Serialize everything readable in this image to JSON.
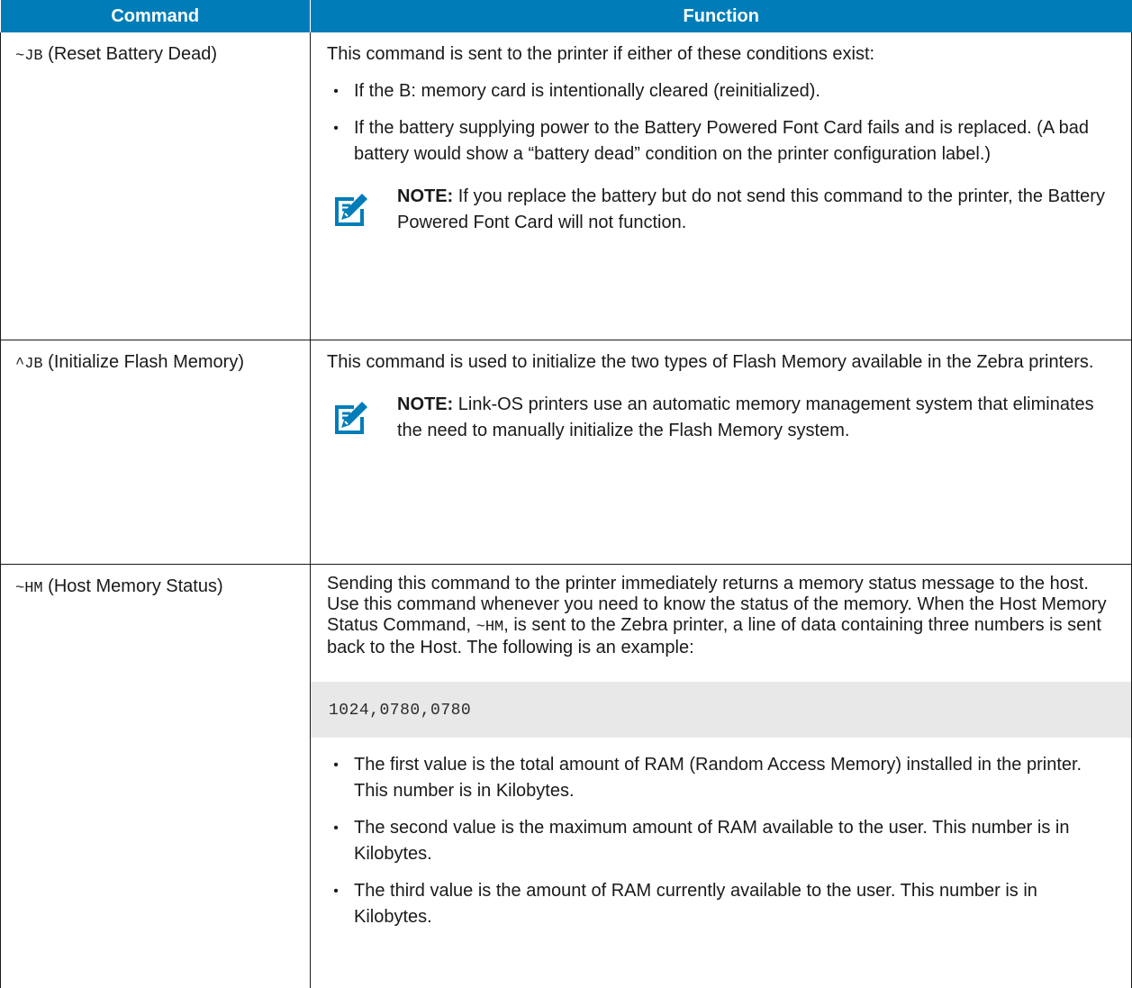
{
  "table": {
    "headers": [
      "Command",
      "Function"
    ],
    "rows": [
      {
        "command_code": "~JB",
        "command_desc": " (Reset Battery Dead)",
        "intro": "This command is sent to the printer if either of these conditions exist:",
        "bullets": [
          "If the B: memory card is intentionally cleared (reinitialized).",
          "If the battery supplying power to the Battery Powered Font Card fails and is replaced. (A bad battery would show a “battery dead” condition on the printer configuration label.)"
        ],
        "note_label": "NOTE:",
        "note_text": " If you replace the battery but do not send this command to the printer, the Battery Powered Font Card will not function."
      },
      {
        "command_code": "^JB",
        "command_desc": " (Initialize Flash Memory)",
        "intro": "This command is used to initialize the two types of Flash Memory available in the Zebra printers.",
        "note_label": "NOTE:",
        "note_text": " Link-OS printers use an automatic memory management system that eliminates the need to manually initialize the Flash Memory system."
      },
      {
        "command_code": "~HM",
        "command_desc": " (Host Memory Status)",
        "intro_a": "Sending this command to the printer immediately returns a memory status message to the host. Use this command whenever you need to know the status of the memory. When the Host Memory Status Command, ",
        "intro_code": "~HM",
        "intro_b": ", is sent to the Zebra printer, a line of data containing three numbers is sent back to the Host. The following is an example:",
        "example": "1024,0780,0780",
        "bullets": [
          "The first value is the total amount of RAM (Random Access Memory) installed in the printer. This number is in Kilobytes.",
          "The second value is the maximum amount of RAM available to the user. This number is in Kilobytes.",
          "The third value is the amount of RAM currently available to the user. This number is in Kilobytes."
        ]
      }
    ]
  },
  "icons": {
    "note": "note-pencil-icon",
    "note_color": "#007db8",
    "bullet": "•"
  },
  "colors": {
    "header_bg": "#007db8",
    "code_bg": "#e8e8e8"
  }
}
